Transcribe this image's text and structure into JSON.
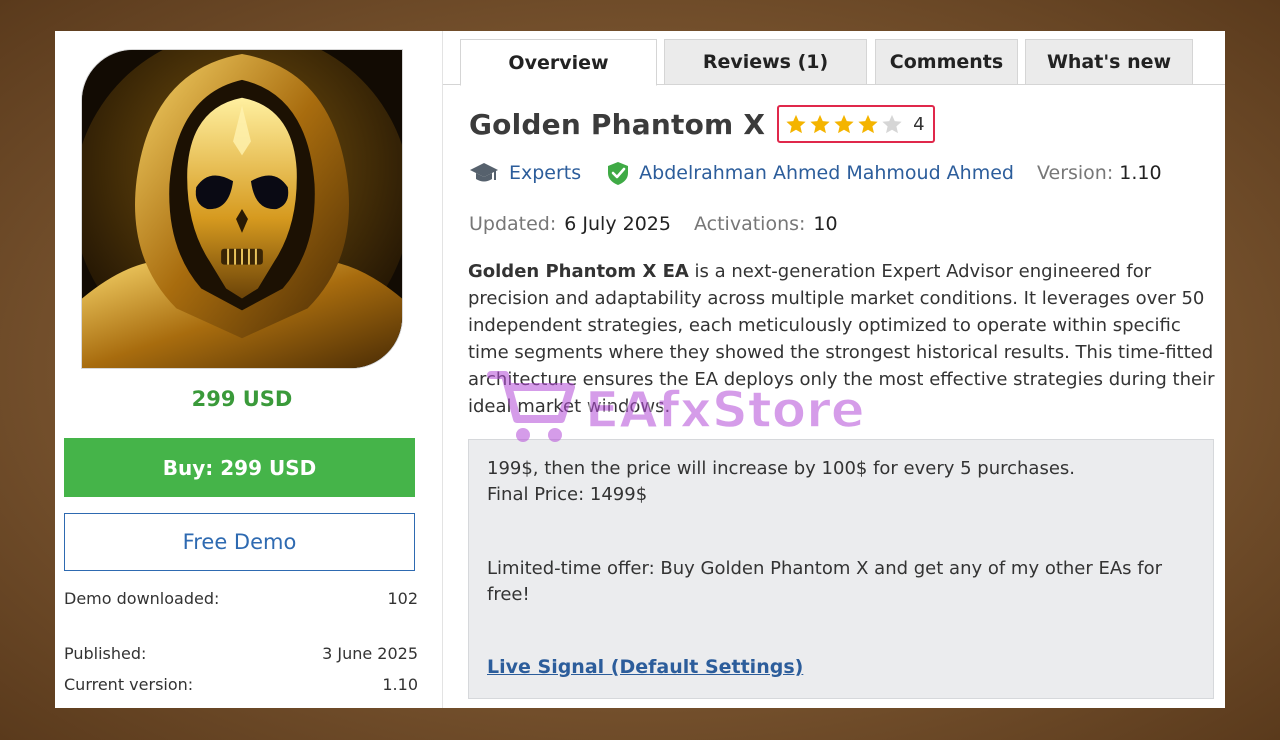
{
  "colors": {
    "buy_green": "#45b449",
    "price_green": "#3a9a3a",
    "link_blue": "#2c5d9b",
    "demo_blue": "#2e6ab1",
    "star_gold": "#f4b400",
    "rating_border": "#e0284b"
  },
  "tabs": [
    {
      "label": "Overview",
      "active": true
    },
    {
      "label": "Reviews (1)",
      "active": false
    },
    {
      "label": "Comments",
      "active": false
    },
    {
      "label": "What's new",
      "active": false
    }
  ],
  "product": {
    "title": "Golden Phantom X",
    "rating": 4,
    "rating_max": 5,
    "rating_text": "4",
    "category": "Experts",
    "category_icon": "graduation-cap-icon",
    "author": "Abdelrahman Ahmed Mahmoud Ahmed",
    "author_icon": "verified-shield-icon",
    "version_label": "Version:",
    "version": "1.10",
    "updated_label": "Updated:",
    "updated": "6 July 2025",
    "activations_label": "Activations:",
    "activations": "10"
  },
  "description": {
    "bold_lead": "Golden Phantom X EA",
    "text": " is a next-generation Expert Advisor engineered for precision and adaptability across multiple market conditions. It leverages over 50 independent strategies, each meticulously optimized to operate within specific time segments where they showed the strongest historical results. This time-fitted architecture ensures the EA deploys only the most effective strategies during their ideal market windows."
  },
  "offer_box": {
    "line1": "199$, then the price will increase by 100$ for every 5 purchases.",
    "line2": "Final Price: 1499$",
    "line3": "Limited-time offer: Buy Golden Phantom X and get any of my other EAs for free!",
    "link": "Live Signal (Default Settings)"
  },
  "sidebar": {
    "price": "299 USD",
    "buy_label": "Buy: 299 USD",
    "demo_label": "Free Demo",
    "stats": [
      {
        "label": "Demo downloaded:",
        "value": "102"
      },
      {
        "label": "Published:",
        "value": "3 June 2025"
      },
      {
        "label": "Current version:",
        "value": "1.10"
      }
    ]
  },
  "watermark": {
    "text": "EAfxStore",
    "icon": "shopping-cart-icon"
  }
}
